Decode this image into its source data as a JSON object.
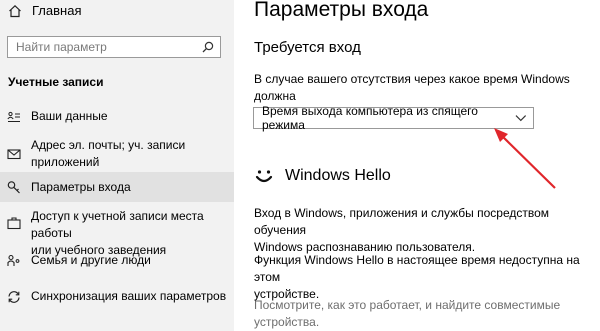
{
  "sidebar": {
    "home_label": "Главная",
    "search_placeholder": "Найти параметр",
    "section_title": "Учетные записи",
    "items": [
      {
        "label": "Ваши данные",
        "icon": "person-card-icon"
      },
      {
        "label": "Адрес эл. почты; уч. записи\nприложений",
        "icon": "mail-icon"
      },
      {
        "label": "Параметры входа",
        "icon": "key-icon"
      },
      {
        "label": "Доступ к учетной записи места работы\nили учебного заведения",
        "icon": "briefcase-icon"
      },
      {
        "label": "Семья и другие люди",
        "icon": "family-icon"
      },
      {
        "label": "Синхронизация ваших параметров",
        "icon": "sync-icon"
      }
    ]
  },
  "main": {
    "title": "Параметры входа",
    "require_signin_heading": "Требуется вход",
    "require_signin_question": "В случае вашего отсутствия через какое время Windows должна\nпотребовать выполнить повторный вход?",
    "dropdown_value": "Время выхода компьютера из спящего режима",
    "hello_heading": "Windows Hello",
    "hello_description": "Вход в Windows, приложения и службы посредством обучения\nWindows распознаванию пользователя.",
    "hello_unavailable": "Функция Windows Hello в настоящее время недоступна на этом\nустройстве.",
    "hello_link_text": "Посмотрите, как это работает, и найдите совместимые\nустройства."
  },
  "colors": {
    "sidebar_bg": "#f2f2f2",
    "selected_bg": "#e1e1e1",
    "annotation_arrow": "#e0262b",
    "muted_text": "#6e6e6e"
  }
}
